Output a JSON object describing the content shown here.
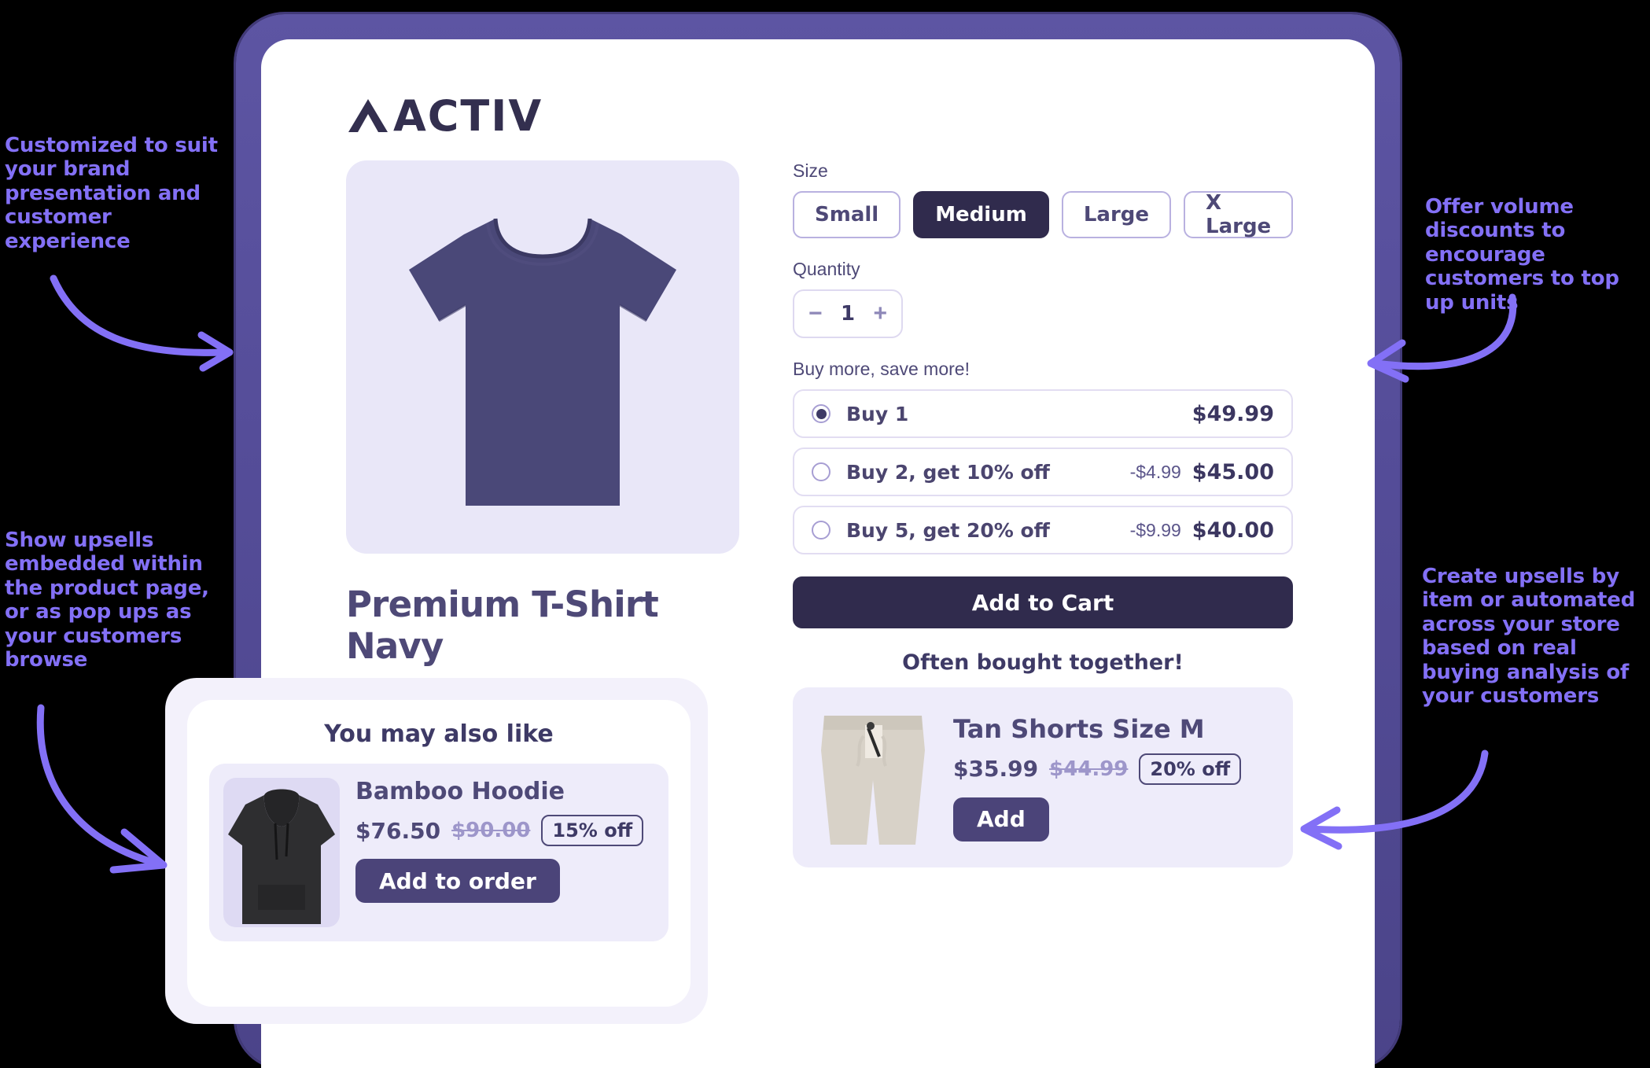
{
  "annotations": {
    "top_left": "Customized to suit your brand presentation and customer experience",
    "bottom_left": "Show upsells embedded within the product page, or as pop ups as your customers browse",
    "top_right": "Offer volume discounts to encourage customers to top up units",
    "bottom_right": "Create upsells by item or automated across your store based on real buying analysis of your customers",
    "accent_color": "#8370f6"
  },
  "store": {
    "logo_text": "ACTIV"
  },
  "product": {
    "title": "Premium T-Shirt Navy",
    "price": "$49.99",
    "image_alt": "navy-tshirt"
  },
  "size": {
    "label": "Size",
    "options": [
      {
        "label": "Small",
        "selected": false
      },
      {
        "label": "Medium",
        "selected": true
      },
      {
        "label": "Large",
        "selected": false
      },
      {
        "label": "X Large",
        "selected": false
      }
    ]
  },
  "quantity": {
    "label": "Quantity",
    "value": "1",
    "decrement": "−",
    "increment": "+"
  },
  "volume_discounts": {
    "label": "Buy more, save more!",
    "tiers": [
      {
        "name": "Buy 1",
        "save": "",
        "price": "$49.99",
        "selected": true
      },
      {
        "name": "Buy 2, get 10% off",
        "save": "-$4.99",
        "price": "$45.00",
        "selected": false
      },
      {
        "name": "Buy 5, get 20% off",
        "save": "-$9.99",
        "price": "$40.00",
        "selected": false
      }
    ]
  },
  "cart": {
    "add_to_cart_label": "Add to Cart"
  },
  "often_bought": {
    "title": "Often bought together!",
    "item": {
      "name": "Tan Shorts Size M",
      "price_now": "$35.99",
      "price_was": "$44.99",
      "discount_badge": "20% off",
      "button_label": "Add"
    }
  },
  "upsell_popup": {
    "title": "You may also like",
    "item": {
      "name": "Bamboo Hoodie",
      "price_now": "$76.50",
      "price_was": "$90.00",
      "discount_badge": "15% off",
      "button_label": "Add to order"
    }
  },
  "colors": {
    "frame": "#554d99",
    "dark": "#302b4d",
    "accent": "#4b4479",
    "lavender": "#e9e7f8"
  }
}
